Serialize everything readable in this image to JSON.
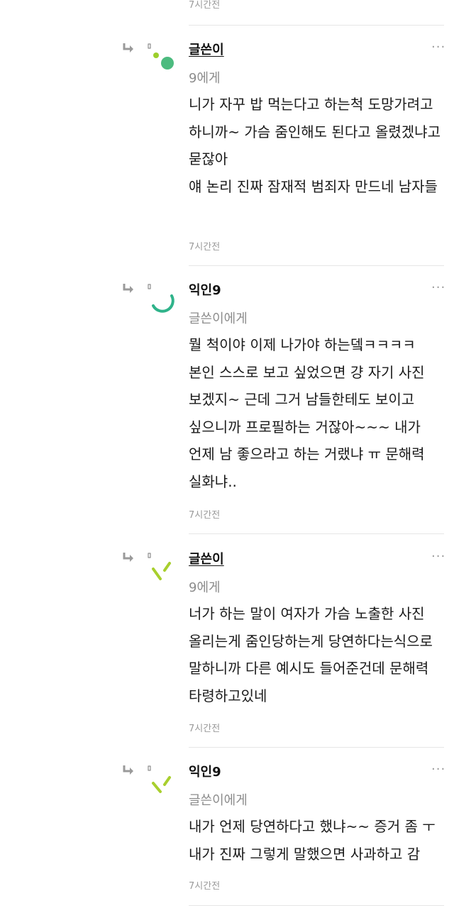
{
  "top_time": "7시간전",
  "comments": [
    {
      "author": "글쓴이",
      "target": "9에게",
      "lines": [
        "니가 자꾸 밥 먹는다고 하는척 도망가려고 하니까~ 가슴 줌인해도 된다고 올렸겠냐고 묻잖아",
        "얘 논리 진짜 잠재적 범죄자 만드네 남자들"
      ],
      "time": "7시간전",
      "more": "···"
    },
    {
      "author": "익인9",
      "target": "글쓴이에게",
      "lines": [
        "뭘 척이야 이제 나가야 하는뎈ㅋㅋㅋㅋ 본인 스스로 보고 싶었으면 걍 자기 사진 보겠지~ 근데 그거 남들한테도 보이고 싶으니까 프로필하는 거잖아~~~ 내가 언제 남 좋으라고 하는 거랬냐 ㅠ 문해력 실화냐.."
      ],
      "time": "7시간전",
      "more": "···"
    },
    {
      "author": "글쓴이",
      "target": "9에게",
      "lines": [
        "너가 하는 말이 여자가 가슴 노출한 사진 올리는게 줌인당하는게 당연하다는식으로 말하니까 다른 예시도 들어준건데 문해력 타령하고있네"
      ],
      "time": "7시간전",
      "more": "···"
    },
    {
      "author": "익인9",
      "target": "글쓴이에게",
      "lines": [
        "내가 언제 당연하다고 했냐~~ 증거 좀 ㅜ",
        "내가 진짜 그렇게 말했으면 사과하고 감"
      ],
      "time": "7시간전",
      "more": "···"
    }
  ],
  "colors": {
    "text": "#1a1a1a",
    "meta": "#9a9a9a",
    "divider": "#e6e6e6",
    "avatar_green": "#4cbb7f",
    "avatar_lime": "#9ccf2c"
  }
}
